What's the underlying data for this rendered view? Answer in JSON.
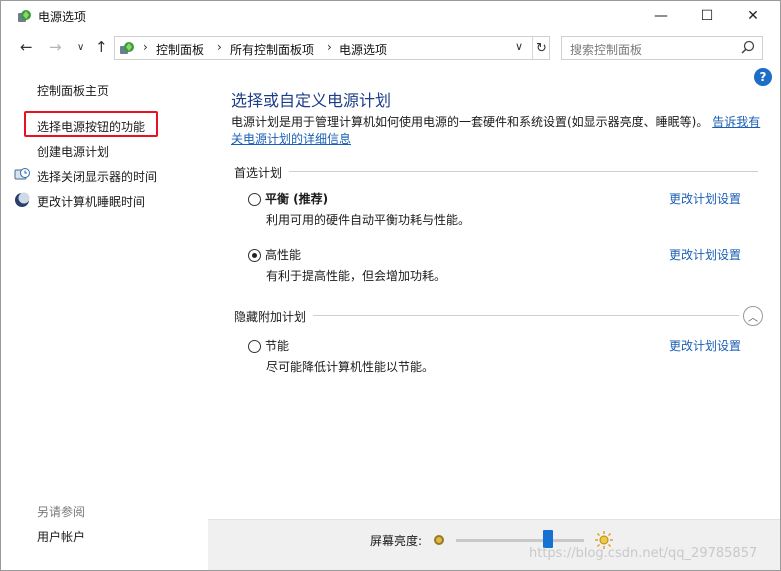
{
  "window": {
    "title": "电源选项",
    "minimize": "—",
    "maximize": "☐",
    "close": "✕"
  },
  "nav": {
    "back": "←",
    "forward": "→",
    "recent": "∨",
    "up": "↑",
    "breadcrumbs": [
      "控制面板",
      "所有控制面板项",
      "电源选项"
    ],
    "search_placeholder": "搜索控制面板"
  },
  "sidebar": {
    "home": "控制面板主页",
    "items": [
      {
        "label": "选择电源按钮的功能",
        "highlighted": true
      },
      {
        "label": "创建电源计划"
      },
      {
        "label": "选择关闭显示器的时间",
        "icon": "monitor-clock-icon"
      },
      {
        "label": "更改计算机睡眠时间",
        "icon": "moon-icon"
      }
    ],
    "see_also_title": "另请参阅",
    "see_also_items": [
      "用户帐户"
    ]
  },
  "main": {
    "help": "?",
    "title": "选择或自定义电源计划",
    "description": "电源计划是用于管理计算机如何使用电源的一套硬件和系统设置(如显示器亮度、睡眠等)。",
    "description_link_1": "告诉我有",
    "description_link_2": "关电源计划的详细信息",
    "preferred_header": "首选计划",
    "hidden_header": "隐藏附加计划",
    "change_label": "更改计划设置",
    "plans": [
      {
        "name": "平衡 (推荐)",
        "desc": "利用可用的硬件自动平衡功耗与性能。",
        "selected": false
      },
      {
        "name": "高性能",
        "desc": "有利于提高性能，但会增加功耗。",
        "selected": true
      },
      {
        "name": "节能",
        "desc": "尽可能降低计算机性能以节能。",
        "selected": false
      }
    ]
  },
  "footer": {
    "brightness_label": "屏幕亮度:",
    "brightness_level": 0.72
  },
  "watermark": "https://blog.csdn.net/qq_29785857",
  "colors": {
    "link": "#1a5fb4",
    "title": "#1c3e87",
    "highlight_border": "#e81123",
    "slider_thumb": "#1572d3"
  }
}
